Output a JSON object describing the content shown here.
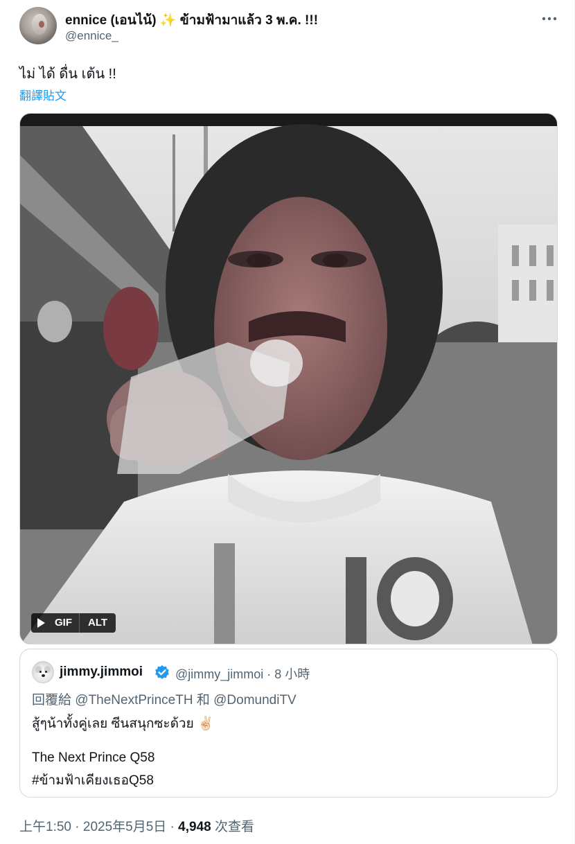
{
  "tweet": {
    "author": {
      "display_name": "ennice (เอนไน้)",
      "display_name_suffix": " ข้ามฟ้ามาแล้ว 3 พ.ค. !!!",
      "sparkle": "✨",
      "handle": "@ennice_"
    },
    "more_icon": "more-horizontal-icon",
    "text": "ไม่ ได้ ดื่น เต้น !!",
    "translate_label": "翻譯貼文",
    "media": {
      "gif_label": "GIF",
      "alt_label": "ALT",
      "play_icon": "play-icon"
    },
    "quote": {
      "name": "jimmy.jimmoi",
      "handle_time": "@jimmy_jimmoi · 8 小時",
      "reply_prefix": "回覆給 ",
      "reply_to_1": "@TheNextPrinceTH",
      "reply_joiner": " 和 ",
      "reply_to_2": "@DomundiTV",
      "line1": "สู้ๆน้าทั้งคู่เลย ซีนสนุกซะด้วย",
      "line1_emoji": "✌🏻",
      "line2": "The Next Prince Q58",
      "line3": "#ข้ามฟ้าเคียงเธอQ58",
      "verified_color": "#1d9bf0"
    },
    "meta": {
      "time": "上午1:50",
      "sep1": " · ",
      "date": "2025年5月5日",
      "sep2": " · ",
      "views_count": "4,948",
      "views_label": " 次查看"
    }
  },
  "colors": {
    "text": "#0f1419",
    "secondary": "#536471",
    "link": "#1d9bf0",
    "border": "#cfd9de"
  }
}
